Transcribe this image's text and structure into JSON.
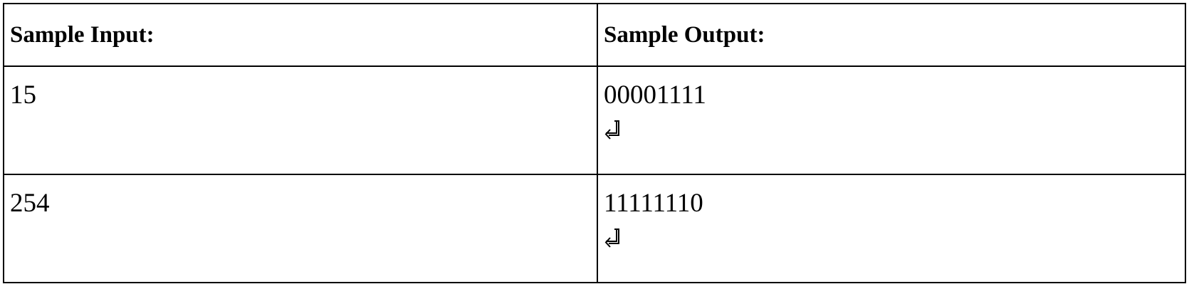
{
  "table": {
    "headers": {
      "input": "Sample Input:",
      "output": "Sample Output:"
    },
    "rows": [
      {
        "input": "15",
        "output": "00001111",
        "output_icon": "return-icon"
      },
      {
        "input": "254",
        "output": "11111110",
        "output_icon": "return-icon"
      }
    ]
  }
}
